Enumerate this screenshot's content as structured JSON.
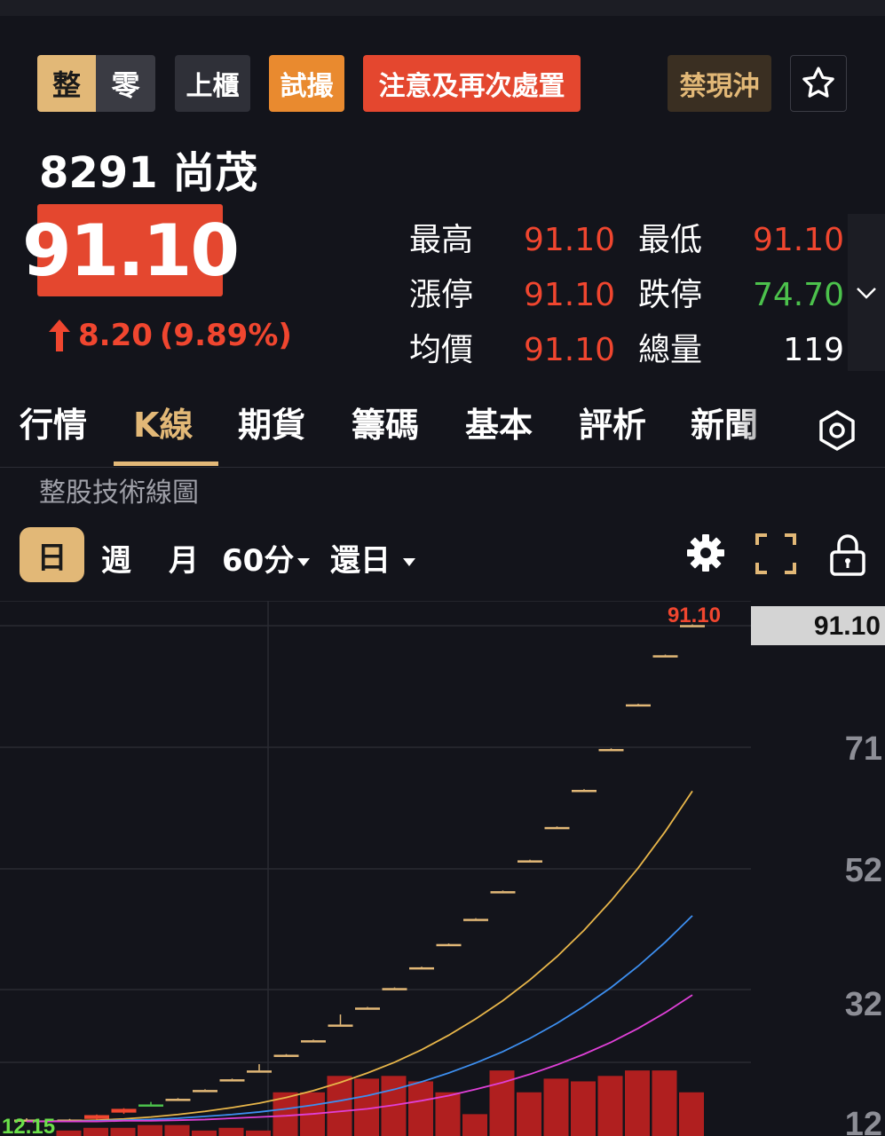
{
  "badges": {
    "seg_whole": "整",
    "seg_odd": "零",
    "market": "上櫃",
    "trial": "試撮",
    "notice": "注意及再次處置",
    "no_daytrade": "禁現沖"
  },
  "stock": {
    "code_name": "8291 尚茂",
    "price": "91.10",
    "change": "8.20",
    "change_pct": "(9.89%)"
  },
  "stats": [
    {
      "k1": "最高",
      "v1": "91.10",
      "k2": "最低",
      "v2": "91.10",
      "v2_color": "red"
    },
    {
      "k1": "漲停",
      "v1": "91.10",
      "k2": "跌停",
      "v2": "74.70",
      "v2_color": "green"
    },
    {
      "k1": "均價",
      "v1": "91.10",
      "k2": "總量",
      "v2": "119",
      "v2_color": "white"
    }
  ],
  "tabs": [
    "行情",
    "K線",
    "期貨",
    "籌碼",
    "基本",
    "評析",
    "新聞"
  ],
  "active_tab": "K線",
  "subtitle": "整股技術線圖",
  "periods": {
    "day": "日",
    "week": "週",
    "month": "月",
    "min60": "60分",
    "restore": "還日"
  },
  "colors": {
    "up": "#f0462f",
    "down": "#4cc24c",
    "accent": "#e2b877",
    "ma1": "#e8b64a",
    "ma2": "#3d8ff0",
    "ma3": "#e040d8",
    "volume": "#b01f1f"
  },
  "chart_data": {
    "type": "candlestick",
    "high_label": "91.10",
    "last_price_tag": "91.10",
    "low_label": "12.15",
    "y_ticks": [
      "91",
      "71",
      "52",
      "32",
      "12"
    ],
    "ylim": [
      12,
      91
    ],
    "candles": [
      {
        "o": 12.5,
        "h": 12.7,
        "l": 12.2,
        "c": 12.3
      },
      {
        "o": 12.3,
        "h": 12.6,
        "l": 12.15,
        "c": 12.5
      },
      {
        "o": 12.6,
        "h": 13.3,
        "l": 12.5,
        "c": 13.2
      },
      {
        "o": 13.6,
        "h": 14.3,
        "l": 13.4,
        "c": 14.2
      },
      {
        "o": 14.9,
        "h": 15.3,
        "l": 14.6,
        "c": 14.6
      },
      {
        "o": 15.8,
        "h": 15.9,
        "l": 15.8,
        "c": 15.8
      },
      {
        "o": 17.2,
        "h": 17.3,
        "l": 17.2,
        "c": 17.2
      },
      {
        "o": 18.9,
        "h": 19.0,
        "l": 18.9,
        "c": 18.9
      },
      {
        "o": 20.3,
        "h": 21.3,
        "l": 20.3,
        "c": 20.3
      },
      {
        "o": 22.8,
        "h": 22.9,
        "l": 22.8,
        "c": 22.8
      },
      {
        "o": 25.1,
        "h": 25.2,
        "l": 25.1,
        "c": 25.1
      },
      {
        "o": 27.6,
        "h": 29.2,
        "l": 27.6,
        "c": 27.6
      },
      {
        "o": 30.3,
        "h": 30.4,
        "l": 30.3,
        "c": 30.3
      },
      {
        "o": 33.4,
        "h": 33.5,
        "l": 33.4,
        "c": 33.4
      },
      {
        "o": 36.7,
        "h": 36.8,
        "l": 36.7,
        "c": 36.7
      },
      {
        "o": 40.4,
        "h": 40.5,
        "l": 40.4,
        "c": 40.4
      },
      {
        "o": 44.4,
        "h": 44.5,
        "l": 44.4,
        "c": 44.4
      },
      {
        "o": 48.8,
        "h": 48.9,
        "l": 48.8,
        "c": 48.8
      },
      {
        "o": 53.7,
        "h": 53.8,
        "l": 53.7,
        "c": 53.7
      },
      {
        "o": 59.0,
        "h": 59.1,
        "l": 59.0,
        "c": 59.0
      },
      {
        "o": 64.9,
        "h": 65.0,
        "l": 64.9,
        "c": 64.9
      },
      {
        "o": 71.4,
        "h": 71.5,
        "l": 71.4,
        "c": 71.4
      },
      {
        "o": 78.5,
        "h": 78.6,
        "l": 78.5,
        "c": 78.5
      },
      {
        "o": 86.3,
        "h": 86.4,
        "l": 86.3,
        "c": 86.3
      },
      {
        "o": 91.1,
        "h": 91.2,
        "l": 91.1,
        "c": 91.1
      }
    ],
    "volumes": [
      2,
      3,
      3,
      4,
      4,
      2,
      3,
      2,
      16,
      16,
      22,
      21,
      22,
      20,
      16,
      8,
      24,
      16,
      21,
      20,
      22,
      24,
      24,
      16
    ],
    "ma": [
      {
        "color": "ma1",
        "values": [
          12.2,
          12.3,
          12.4,
          12.6,
          12.9,
          13.3,
          13.8,
          14.4,
          15.1,
          16.0,
          17.1,
          18.4,
          19.9,
          21.6,
          23.6,
          25.9,
          28.5,
          31.4,
          34.7,
          38.4,
          42.6,
          47.3,
          52.5,
          58.3,
          64.7
        ]
      },
      {
        "color": "ma2",
        "values": [
          12.2,
          12.2,
          12.3,
          12.4,
          12.5,
          12.7,
          13.0,
          13.3,
          13.7,
          14.2,
          14.8,
          15.5,
          16.3,
          17.3,
          18.5,
          19.9,
          21.5,
          23.3,
          25.4,
          27.8,
          30.5,
          33.5,
          36.9,
          40.7,
          44.9
        ]
      },
      {
        "color": "ma3",
        "values": [
          12.2,
          12.2,
          12.2,
          12.3,
          12.3,
          12.4,
          12.5,
          12.7,
          12.9,
          13.1,
          13.4,
          13.8,
          14.2,
          14.8,
          15.5,
          16.3,
          17.3,
          18.4,
          19.7,
          21.2,
          22.9,
          24.8,
          27.0,
          29.5,
          32.3
        ]
      }
    ]
  }
}
